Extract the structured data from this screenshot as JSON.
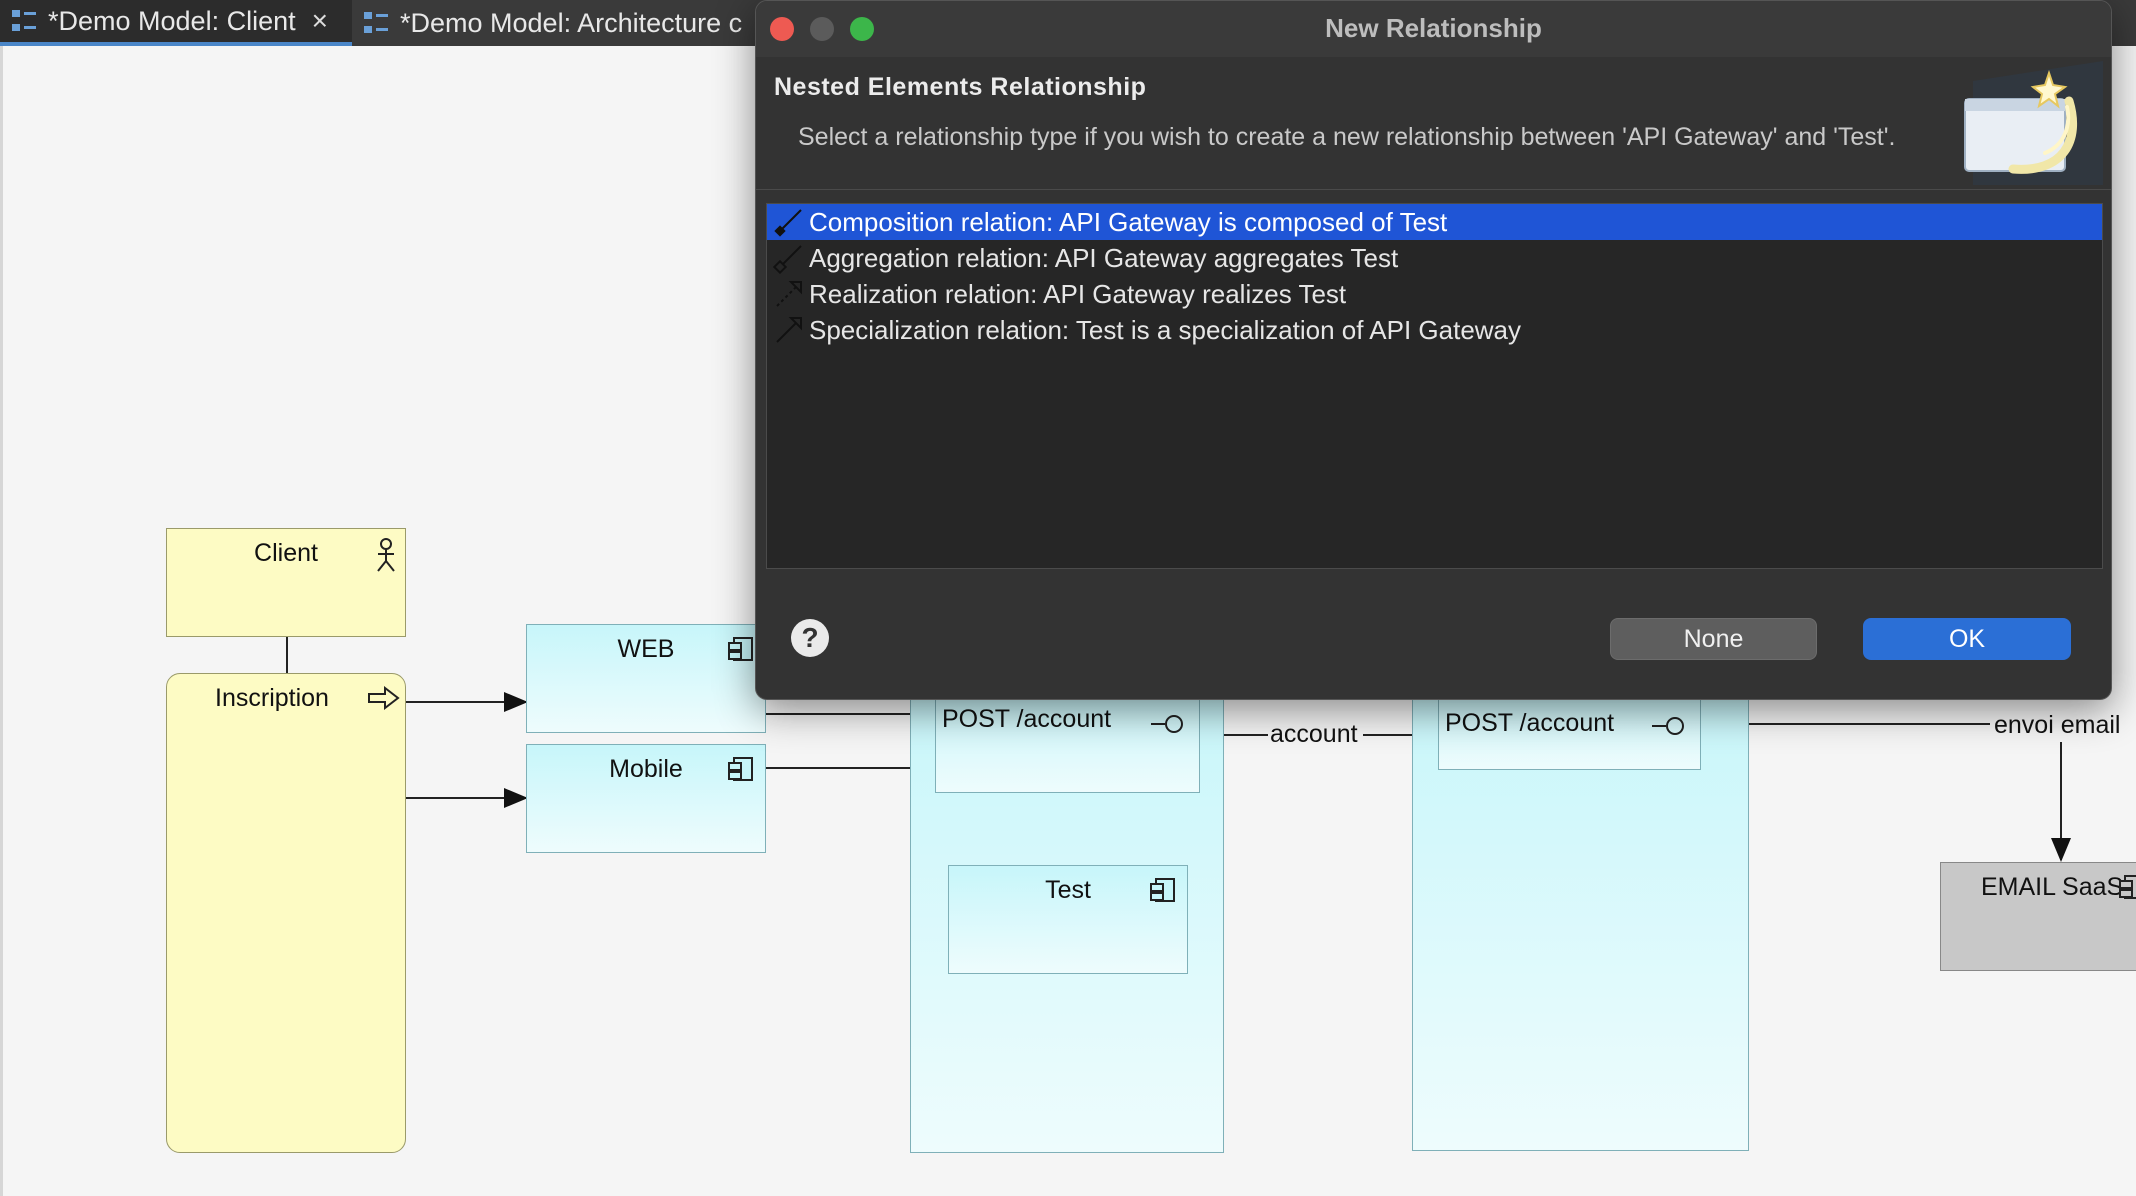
{
  "tabs": [
    {
      "label": "*Demo Model: Client",
      "active": true,
      "close": "×"
    },
    {
      "label": "*Demo Model: Architecture c",
      "active": false
    }
  ],
  "diagram": {
    "nodes": {
      "client": "Client",
      "inscription": "Inscription",
      "web": "WEB",
      "mobile": "Mobile",
      "post1": "POST /account",
      "test": "Test",
      "post2": "POST /account",
      "email": "EMAIL SaaS"
    },
    "edge_labels": {
      "account": "account",
      "envoi": "envoi email"
    }
  },
  "dialog": {
    "title": "New Relationship",
    "header_title": "Nested Elements Relationship",
    "description": "Select a relationship type if you wish to create a new relationship between 'API Gateway' and 'Test'.",
    "options": [
      {
        "label": "Composition relation: API Gateway is composed of Test",
        "icon": "composition-icon",
        "selected": true
      },
      {
        "label": "Aggregation relation: API Gateway aggregates Test",
        "icon": "aggregation-icon",
        "selected": false
      },
      {
        "label": "Realization relation: API Gateway realizes Test",
        "icon": "realization-icon",
        "selected": false
      },
      {
        "label": "Specialization relation: Test is a specialization of API Gateway",
        "icon": "specialization-icon",
        "selected": false
      }
    ],
    "help": "?",
    "none_button": "None",
    "ok_button": "OK"
  },
  "colors": {
    "selection": "#1f55d6",
    "ok_button": "#2b6fd6",
    "application_fill": "#c7f6fa",
    "business_fill": "#fdfbc4"
  }
}
